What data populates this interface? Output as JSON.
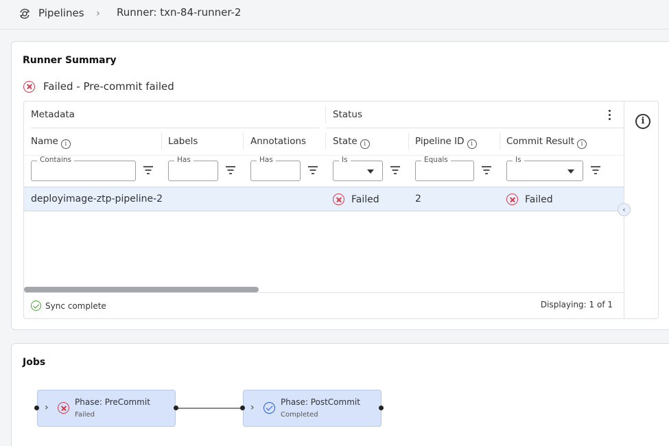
{
  "breadcrumb": {
    "root": "Pipelines",
    "separator": "›",
    "current": "Runner: txn-84-runner-2"
  },
  "summary": {
    "title": "Runner Summary",
    "status_text": "Failed - Pre-commit failed",
    "groups": {
      "metadata": "Metadata",
      "status": "Status"
    },
    "columns": {
      "name": "Name",
      "labels": "Labels",
      "annotations": "Annotations",
      "state": "State",
      "pipeline_id": "Pipeline ID",
      "commit_result": "Commit Result"
    },
    "filters": {
      "name": "Contains",
      "labels": "Has",
      "annotations": "Has",
      "state": "Is",
      "pipeline_id": "Equals",
      "commit_result": "Is"
    },
    "rows": [
      {
        "name": "deployimage-ztp-pipeline-2",
        "labels": "",
        "annotations": "",
        "state": "Failed",
        "pipeline_id": "2",
        "commit_result": "Failed"
      }
    ],
    "sync_status": "Sync complete",
    "displaying": "Displaying: 1 of 1"
  },
  "jobs": {
    "title": "Jobs",
    "nodes": [
      {
        "title": "Phase: PreCommit",
        "status": "Failed"
      },
      {
        "title": "Phase: PostCommit",
        "status": "Completed"
      }
    ]
  },
  "colors": {
    "error": "#d43d4e",
    "success": "#4aa53a",
    "accent": "#2a5bd7",
    "selected_row": "#e8f0fb",
    "job_node": "#d6e3fb"
  },
  "icons": {
    "breadcrumb": "pipeline-sync-icon",
    "failed": "error-circle-icon",
    "completed": "check-circle-icon",
    "sync": "check-circle-icon",
    "info": "info-icon",
    "menu": "kebab-menu-icon",
    "filter": "filter-icon"
  }
}
